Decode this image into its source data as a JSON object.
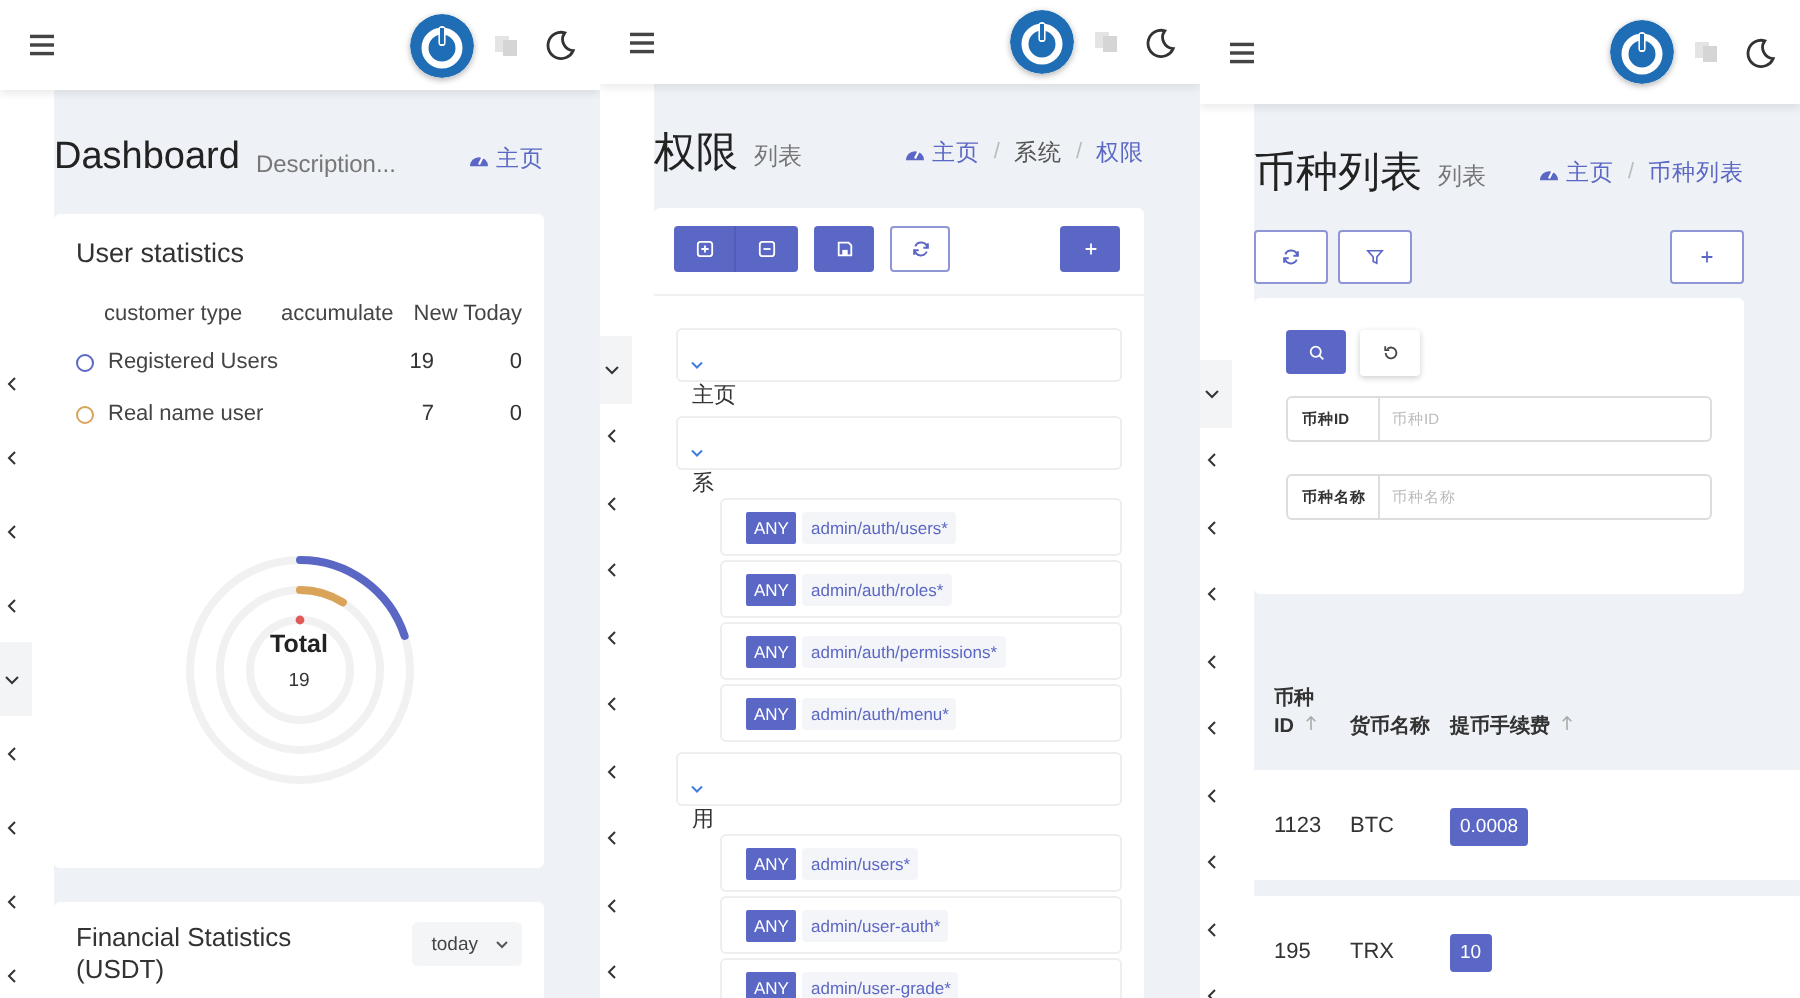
{
  "dashboard": {
    "sidebar": [
      {
        "expanded": false
      },
      {
        "expanded": false
      },
      {
        "expanded": false
      },
      {
        "expanded": false
      },
      {
        "expanded": true
      },
      {
        "expanded": false
      },
      {
        "expanded": false
      },
      {
        "expanded": false
      },
      {
        "expanded": false
      }
    ],
    "title": "Dashboard",
    "description": "Description...",
    "breadcrumb": [
      {
        "label": "主页",
        "link": true
      }
    ],
    "user_stats": {
      "title": "User statistics",
      "columns": [
        "customer type",
        "accumulate",
        "New Today"
      ],
      "rows": [
        {
          "name": "Registered Users",
          "accumulate": "19",
          "today": "0",
          "color": "#5b67c4"
        },
        {
          "name": "Real name user",
          "accumulate": "7",
          "today": "0",
          "color": "#d9a35a"
        }
      ],
      "total_label": "Total",
      "total_value": "19"
    },
    "finance": {
      "title": "Financial Statistics (USDT)",
      "period": "today"
    }
  },
  "permissions": {
    "sidebar": [
      {
        "expanded": true
      },
      {
        "expanded": false
      },
      {
        "expanded": false
      },
      {
        "expanded": false
      },
      {
        "expanded": false
      },
      {
        "expanded": false
      },
      {
        "expanded": false
      },
      {
        "expanded": false
      },
      {
        "expanded": false
      },
      {
        "expanded": false
      }
    ],
    "title": "权限",
    "subtitle": "列表",
    "breadcrumb": [
      {
        "label": "主页",
        "link": true
      },
      {
        "separator": "/",
        "label": "系统",
        "link": false
      },
      {
        "separator": "/",
        "label": "权限",
        "link": true
      }
    ],
    "tree": [
      {
        "label": "主页"
      },
      {
        "label": "系",
        "children": [
          {
            "method": "ANY",
            "path": "admin/auth/users*"
          },
          {
            "method": "ANY",
            "path": "admin/auth/roles*"
          },
          {
            "method": "ANY",
            "path": "admin/auth/permissions*"
          },
          {
            "method": "ANY",
            "path": "admin/auth/menu*"
          }
        ]
      },
      {
        "label": "用",
        "children": [
          {
            "method": "ANY",
            "path": "admin/users*"
          },
          {
            "method": "ANY",
            "path": "admin/user-auth*"
          },
          {
            "method": "ANY",
            "path": "admin/user-grade*"
          }
        ]
      }
    ]
  },
  "currencies": {
    "sidebar": [
      {
        "expanded": true
      },
      {
        "expanded": false
      },
      {
        "expanded": false
      },
      {
        "expanded": false
      },
      {
        "expanded": false
      },
      {
        "expanded": false
      },
      {
        "expanded": false
      },
      {
        "expanded": false
      },
      {
        "expanded": false
      },
      {
        "expanded": false
      }
    ],
    "title": "币种列表",
    "subtitle": "列表",
    "breadcrumb": [
      {
        "label": "主页",
        "link": true
      },
      {
        "separator": "/",
        "label": "币种列表",
        "link": true
      }
    ],
    "filters": [
      {
        "label": "币种ID",
        "placeholder": "币种ID"
      },
      {
        "label": "币种名称",
        "placeholder": "币种名称"
      }
    ],
    "columns": [
      {
        "label": "币种 ID",
        "sortable": true
      },
      {
        "label": "货币名称",
        "sortable": false
      },
      {
        "label": "提币手续费",
        "sortable": true
      }
    ],
    "rows": [
      {
        "id": "1123",
        "name": "BTC",
        "fee": "0.0008"
      },
      {
        "id": "195",
        "name": "TRX",
        "fee": "10"
      }
    ]
  }
}
